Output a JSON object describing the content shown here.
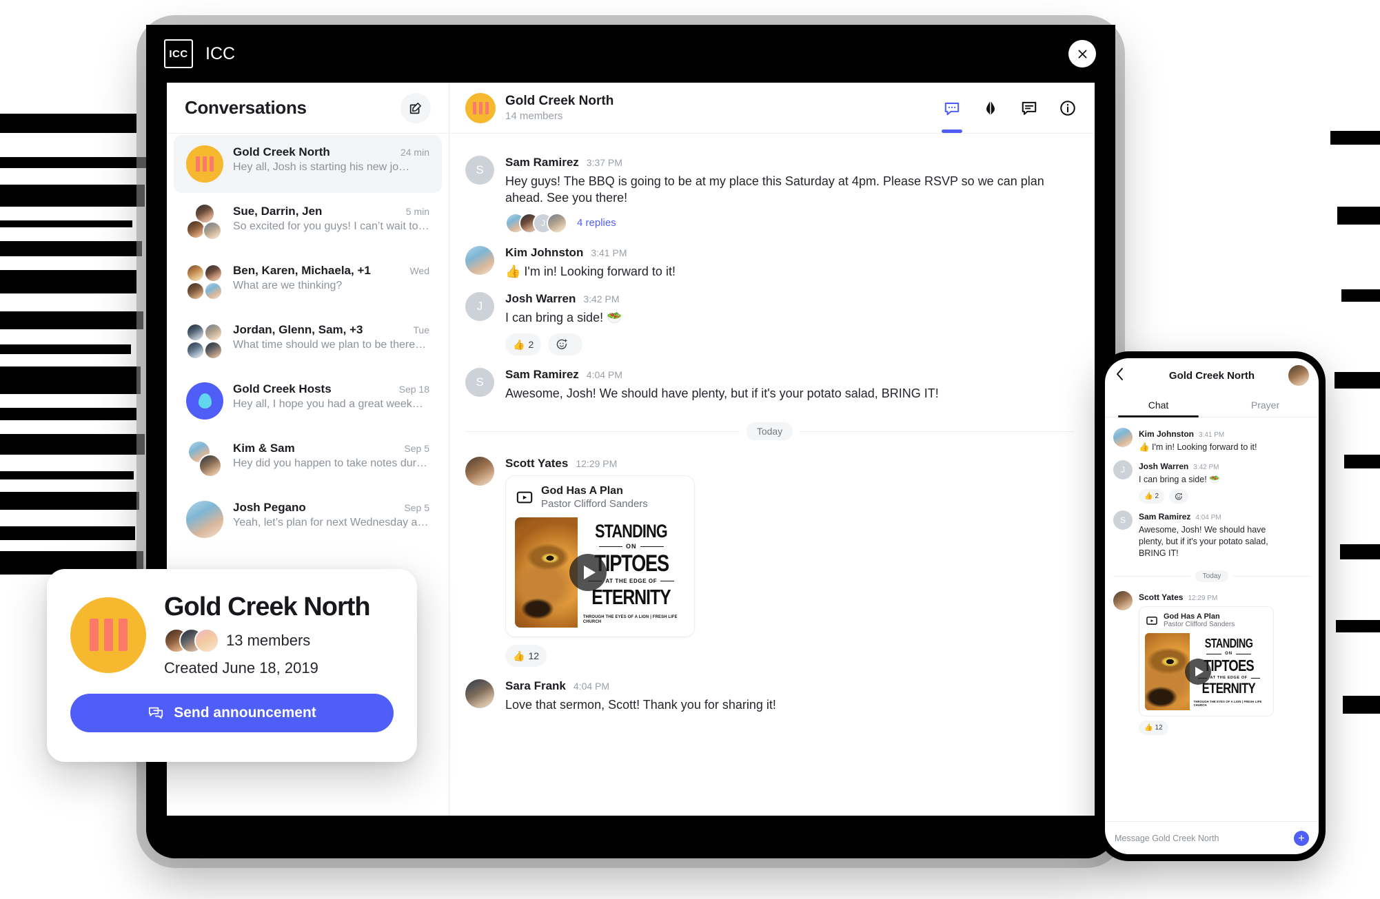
{
  "app": {
    "logo_text": "ICC",
    "title": "ICC",
    "close_icon": "close-icon"
  },
  "conversations_panel": {
    "heading": "Conversations",
    "compose_icon": "compose-icon",
    "items": [
      {
        "name": "Gold Creek North",
        "time": "24 min",
        "preview": "Hey all, Josh is starting his new jo…",
        "avatar_kind": "group-gold"
      },
      {
        "name": "Sue, Darrin, Jen",
        "time": "5 min",
        "preview": "So excited for you guys! I can’t wait to…",
        "avatar_kind": "stack-3"
      },
      {
        "name": "Ben, Karen, Michaela, +1",
        "time": "Wed",
        "preview": "What are we thinking?",
        "avatar_kind": "stack-4"
      },
      {
        "name": "Jordan, Glenn, Sam, +3",
        "time": "Tue",
        "preview": "What time should we plan to be there…",
        "avatar_kind": "stack-4"
      },
      {
        "name": "Gold Creek Hosts",
        "time": "Sep 18",
        "preview": "Hey all, I hope you had a great week…",
        "avatar_kind": "group-blue"
      },
      {
        "name": "Kim & Sam",
        "time": "Sep 5",
        "preview": "Hey did you happen to take notes duri…",
        "avatar_kind": "stack-2"
      },
      {
        "name": "Josh Pegano",
        "time": "Sep 5",
        "preview": "Yeah, let’s plan for next Wednesday at…",
        "avatar_kind": "photo"
      }
    ]
  },
  "chat_header": {
    "title": "Gold Creek North",
    "members": "14 members",
    "tabs": [
      {
        "icon": "chat-bubble-icon",
        "active": true
      },
      {
        "icon": "praying-hands-icon",
        "active": false
      },
      {
        "icon": "announcement-icon",
        "active": false
      },
      {
        "icon": "info-icon",
        "active": false
      }
    ]
  },
  "messages": [
    {
      "author": "Sam Ramirez",
      "time": "3:37 PM",
      "initial": "S",
      "text": "Hey guys! The BBQ is going to be at my place this Saturday at 4pm. Please RSVP so we can plan ahead. See you there!",
      "thread_label": "4 replies"
    },
    {
      "author": "Kim Johnston",
      "time": "3:41 PM",
      "text": "👍 I'm in! Looking forward to it!"
    },
    {
      "author": "Josh Warren",
      "time": "3:42 PM",
      "initial": "J",
      "text": "I can bring a side! 🥗",
      "reactions": [
        {
          "emoji": "👍",
          "count": "2"
        },
        {
          "emoji": "add-reaction-icon",
          "count": ""
        }
      ]
    },
    {
      "author": "Sam Ramirez",
      "time": "4:04 PM",
      "initial": "S",
      "text": "Awesome, Josh! We should have plenty, but if it's your potato salad, BRING IT!"
    }
  ],
  "day_divider": "Today",
  "sermon_message": {
    "author": "Scott Yates",
    "time": "12:29 PM",
    "card": {
      "title": "God Has A Plan",
      "speaker": "Pastor Clifford Sanders",
      "video_icon": "video-icon",
      "play_icon": "play-icon",
      "art": {
        "line1": "STANDING",
        "small1": "ON",
        "line2": "TIPTOES",
        "small2": "AT THE EDGE OF",
        "line3": "ETERNITY",
        "footer": "THROUGH THE EYES OF A LION | FRESH LIFE CHURCH"
      }
    },
    "reaction": {
      "emoji": "👍",
      "count": "12"
    }
  },
  "last_message": {
    "author": "Sara Frank",
    "time": "4:04 PM",
    "text": "Love that sermon, Scott! Thank you for sharing it!"
  },
  "group_card": {
    "title": "Gold Creek North",
    "members": "13 members",
    "created": "Created June 18, 2019",
    "button_label": "Send announcement",
    "button_icon": "announcement-icon",
    "button_color": "#4f5ef7"
  },
  "phone": {
    "back_icon": "back-chevron-icon",
    "title": "Gold Creek North",
    "avatar": "user-avatar",
    "tabs": [
      {
        "label": "Chat",
        "active": true
      },
      {
        "label": "Prayer",
        "active": false
      }
    ],
    "messages": [
      {
        "author": "Kim Johnston",
        "time": "3:41 PM",
        "text": "👍 I'm in! Looking forward to it!"
      },
      {
        "author": "Josh Warren",
        "time": "3:42 PM",
        "initial": "J",
        "text": "I can bring a side! 🥗",
        "reactions": [
          {
            "emoji": "👍",
            "count": "2"
          },
          {
            "emoji": "add-reaction-icon",
            "count": ""
          }
        ]
      },
      {
        "author": "Sam Ramirez",
        "time": "4:04 PM",
        "initial": "S",
        "text": "Awesome, Josh! We should have plenty, but if it's your potato salad, BRING IT!"
      }
    ],
    "day_divider": "Today",
    "sermon_message": {
      "author": "Scott Yates",
      "time": "12:29 PM",
      "card": {
        "title": "God Has A Plan",
        "speaker": "Pastor Clifford Sanders"
      },
      "reaction": {
        "emoji": "👍",
        "count": "12"
      }
    },
    "composer": {
      "placeholder": "Message Gold Creek North",
      "plus_icon": "plus-icon"
    }
  },
  "colors": {
    "accent_blue": "#4f5ef7",
    "group_gold": "#f5b82e",
    "group_gold_bars": "#fc7a6a",
    "group_blue": "#4f5ef7",
    "text_primary": "#1b1d21",
    "text_muted": "#8d939b"
  }
}
